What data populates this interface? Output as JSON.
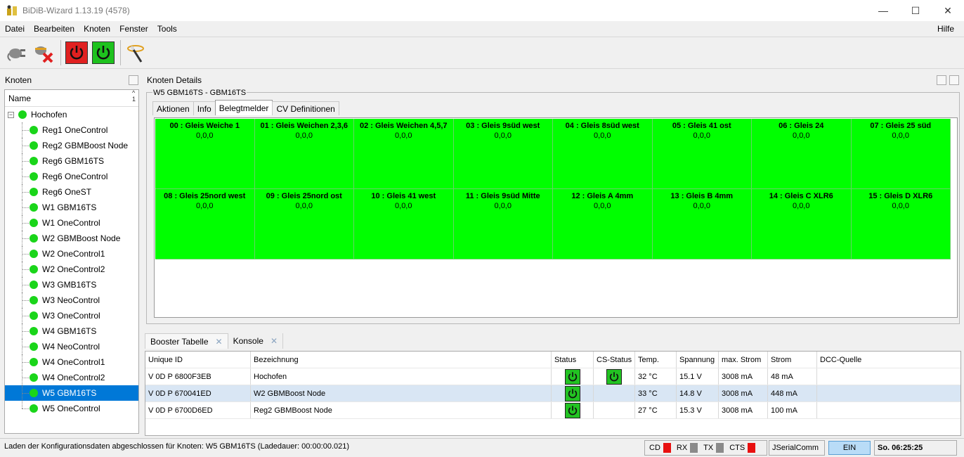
{
  "window": {
    "title": "BiDiB-Wizard 1.13.19 (4578)",
    "minimize": "—",
    "maximize": "☐",
    "close": "✕"
  },
  "menu": {
    "items": [
      "Datei",
      "Bearbeiten",
      "Knoten",
      "Fenster",
      "Tools"
    ],
    "help": "Hilfe"
  },
  "toolbar": {
    "icons": [
      "plug-icon",
      "disconnect-icon",
      "power-off-icon",
      "power-on-icon",
      "wand-icon"
    ],
    "colors": {
      "power_off": "#e02020",
      "power_on": "#1ec21e"
    }
  },
  "nodes_panel": {
    "title": "Knoten",
    "column": "Name",
    "sort_indicator": "1",
    "root": "Hochofen",
    "children": [
      "Reg1 OneControl",
      "Reg2 GBMBoost Node",
      "Reg6 GBM16TS",
      "Reg6 OneControl",
      "Reg6 OneST",
      "W1 GBM16TS",
      "W1 OneControl",
      "W2 GBMBoost Node",
      "W2 OneControl1",
      "W2 OneControl2",
      "W3 GMB16TS",
      "W3 NeoControl",
      "W3 OneControl",
      "W4 GBM16TS",
      "W4 NeoControl",
      "W4 OneControl1",
      "W4 OneControl2",
      "W5 GBM16TS",
      "W5 OneControl"
    ],
    "selected_index": 17,
    "status_color": "#1ad51a"
  },
  "details_panel": {
    "title": "Knoten Details",
    "group_title": "W5 GBM16TS - GBM16TS",
    "tabs": [
      "Aktionen",
      "Info",
      "Belegtmelder",
      "CV Definitionen"
    ],
    "active_tab": 2,
    "occupancy": [
      {
        "label": "00 : Gleis Weiche 1",
        "value": "0,0,0"
      },
      {
        "label": "01 : Gleis Weichen 2,3,6",
        "value": "0,0,0"
      },
      {
        "label": "02 : Gleis Weichen 4,5,7",
        "value": "0,0,0"
      },
      {
        "label": "03 : Gleis 9süd west",
        "value": "0,0,0"
      },
      {
        "label": "04 : Gleis 8süd west",
        "value": "0,0,0"
      },
      {
        "label": "05 : Gleis 41 ost",
        "value": "0,0,0"
      },
      {
        "label": "06 : Gleis 24",
        "value": "0,0,0"
      },
      {
        "label": "07 : Gleis 25 süd",
        "value": "0,0,0"
      },
      {
        "label": "08 : Gleis 25nord west",
        "value": "0,0,0"
      },
      {
        "label": "09 : Gleis 25nord ost",
        "value": "0,0,0"
      },
      {
        "label": "10 : Gleis 41 west",
        "value": "0,0,0"
      },
      {
        "label": "11 : Gleis 9süd Mitte",
        "value": "0,0,0"
      },
      {
        "label": "12 : Gleis A 4mm",
        "value": "0,0,0"
      },
      {
        "label": "13 : Gleis B 4mm",
        "value": "0,0,0"
      },
      {
        "label": "14 : Gleis C XLR6",
        "value": "0,0,0"
      },
      {
        "label": "15 : Gleis D XLR6",
        "value": "0,0,0"
      }
    ],
    "occupied_color": "#00ff00"
  },
  "bottom_panel": {
    "tabs": [
      "Booster Tabelle",
      "Konsole"
    ],
    "active_tab": 0,
    "columns": [
      "Unique ID",
      "Bezeichnung",
      "Status",
      "CS-Status",
      "Temp.",
      "Spannung",
      "max. Strom",
      "Strom",
      "DCC-Quelle"
    ],
    "rows": [
      {
        "uid": "V 0D P 6800F3EB",
        "name": "Hochofen",
        "status": true,
        "cs_status": true,
        "temp": "32 °C",
        "voltage": "15.1 V",
        "max_current": "3008 mA",
        "current": "48 mA",
        "dcc": ""
      },
      {
        "uid": "V 0D P 670041ED",
        "name": "W2 GBMBoost Node",
        "status": true,
        "cs_status": false,
        "temp": "33 °C",
        "voltage": "14.8 V",
        "max_current": "3008 mA",
        "current": "448 mA",
        "dcc": ""
      },
      {
        "uid": "V 0D P 6700D6ED",
        "name": "Reg2 GBMBoost Node",
        "status": true,
        "cs_status": false,
        "temp": "27 °C",
        "voltage": "15.3 V",
        "max_current": "3008 mA",
        "current": "100 mA",
        "dcc": ""
      }
    ],
    "selected_row": 1
  },
  "statusbar": {
    "message": "Laden der Konfigurationsdaten abgeschlossen für Knoten: W5 GBM16TS (Ladedauer: 00:00:00.021)",
    "leds": [
      {
        "label": "CD",
        "color": "#e81010"
      },
      {
        "label": "RX",
        "color": "#8a8a8a"
      },
      {
        "label": "TX",
        "color": "#8a8a8a"
      },
      {
        "label": "CTS",
        "color": "#e81010"
      }
    ],
    "port": "JSerialComm",
    "power": "EIN",
    "time": "So. 06:25:25"
  }
}
